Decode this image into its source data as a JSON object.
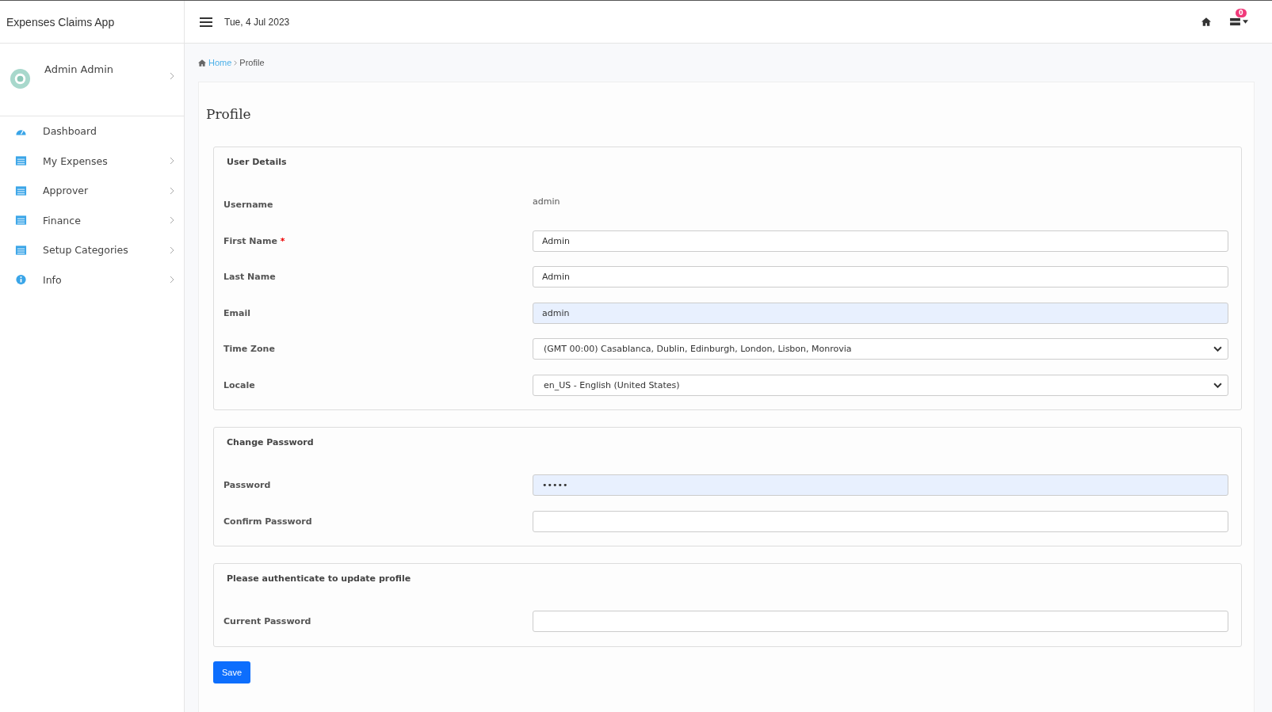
{
  "app_title": "Expenses Claims App",
  "header": {
    "date": "Tue, 4 Jul 2023",
    "notification_count": "0"
  },
  "user": {
    "name": "Admin Admin"
  },
  "sidebar": {
    "items": [
      {
        "label": "Dashboard",
        "kind": "gauge",
        "expandable": false
      },
      {
        "label": "My Expenses",
        "kind": "list",
        "expandable": true
      },
      {
        "label": "Approver",
        "kind": "list",
        "expandable": true
      },
      {
        "label": "Finance",
        "kind": "list",
        "expandable": true
      },
      {
        "label": "Setup Categories",
        "kind": "list",
        "expandable": true
      },
      {
        "label": "Info",
        "kind": "info",
        "expandable": true
      }
    ]
  },
  "breadcrumb": [
    {
      "label": "Home",
      "link": true
    },
    {
      "label": "Profile",
      "link": false
    }
  ],
  "page_title": "Profile",
  "sections": [
    {
      "title": "User Details",
      "fields": [
        {
          "label": "Username",
          "kind": "static",
          "value": "admin"
        },
        {
          "label": "First Name",
          "kind": "input",
          "value": "Admin",
          "required_mark": "*",
          "autofilled": false
        },
        {
          "label": "Last Name",
          "kind": "input",
          "value": "Admin",
          "autofilled": false
        },
        {
          "label": "Email",
          "kind": "input",
          "value": "admin",
          "autofilled": true
        },
        {
          "label": "Time Zone",
          "kind": "select",
          "value": "(GMT 00:00) Casablanca, Dublin, Edinburgh, London, Lisbon, Monrovia",
          "autofilled": false
        },
        {
          "label": "Locale",
          "kind": "select",
          "value": "en_US - English (United States)",
          "autofilled": false
        }
      ]
    },
    {
      "title": "Change Password",
      "fields": [
        {
          "label": "Password",
          "kind": "input",
          "value": "•••••",
          "autofilled": true
        },
        {
          "label": "Confirm Password",
          "kind": "input",
          "autofilled": false
        }
      ]
    },
    {
      "title": "Please authenticate to update profile",
      "fields": [
        {
          "label": "Current Password",
          "kind": "input",
          "autofilled": false
        }
      ]
    }
  ],
  "save_button": "Save"
}
